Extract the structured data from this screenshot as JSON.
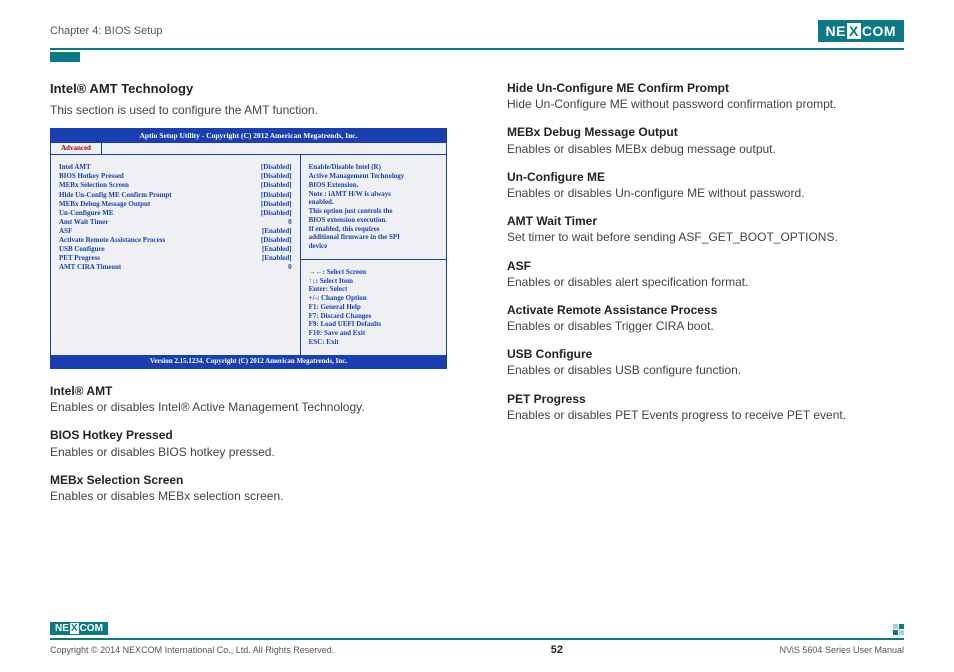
{
  "header": {
    "chapter": "Chapter 4: BIOS Setup",
    "logo_pre": "NE",
    "logo_x": "X",
    "logo_post": "COM"
  },
  "left": {
    "title": "Intel® AMT Technology",
    "intro": "This section is used to configure the AMT function.",
    "bios": {
      "title": "Aptio Setup Utility - Copyright (C) 2012 American Megatrends, Inc.",
      "tab": "Advanced",
      "rows": [
        {
          "k": "Intel AMT",
          "v": "[Disabled]"
        },
        {
          "k": "BIOS Hotkey Pressed",
          "v": "[Disabled]"
        },
        {
          "k": "MEBx Selection Screen",
          "v": "[Disabled]"
        },
        {
          "k": "Hide Un-Config ME Confirm Prompt",
          "v": "[Disabled]"
        },
        {
          "k": "MEBx Debug Message Output",
          "v": "[Disabled]"
        },
        {
          "k": "Un-Configure ME",
          "v": "[Disabled]"
        },
        {
          "k": "Amt Wait Timer",
          "v": "0"
        },
        {
          "k": "ASF",
          "v": "[Enabled]"
        },
        {
          "k": "Activate Remote Assistance Process",
          "v": "[Disabled]"
        },
        {
          "k": "USB Configure",
          "v": "[Enabled]"
        },
        {
          "k": "PET Progress",
          "v": "[Enabled]"
        },
        {
          "k": "AMT CIRA Timeout",
          "v": "0"
        }
      ],
      "help_top": [
        "Enable/Disable Intel (R)",
        "Active Management Technology",
        "BIOS Extension.",
        "Note : iAMT H/W is always",
        "enabled.",
        "This option just controls the",
        "BIOS extension execution.",
        "If enabled, this requires",
        "additional firmware in the SPI",
        "device"
      ],
      "help_bot": [
        "→←: Select Screen",
        "↑↓: Select Item",
        "Enter: Select",
        "+/-: Change Option",
        "F1: General Help",
        "F7: Discard Changes",
        "F9: Load UEFI Defaults",
        "F10: Save and Exit",
        "ESC: Exit"
      ],
      "footer": "Version 2.15.1234. Copyright (C) 2012 American Megatrends, Inc."
    },
    "items": [
      {
        "label": "Intel® AMT",
        "desc": "Enables or disables Intel® Active Management Technology."
      },
      {
        "label": "BIOS Hotkey Pressed",
        "desc": "Enables or disables BIOS hotkey pressed."
      },
      {
        "label": "MEBx Selection Screen",
        "desc": "Enables or disables MEBx selection screen."
      }
    ]
  },
  "right": {
    "items": [
      {
        "label": "Hide Un-Configure ME Confirm Prompt",
        "desc": "Hide Un-Configure ME without password confirmation prompt."
      },
      {
        "label": "MEBx Debug Message Output",
        "desc": "Enables or disables MEBx debug message output."
      },
      {
        "label": "Un-Configure ME",
        "desc": "Enables or disables Un-configure ME without password."
      },
      {
        "label": "AMT Wait Timer",
        "desc": "Set timer to wait before sending ASF_GET_BOOT_OPTIONS."
      },
      {
        "label": "ASF",
        "desc": "Enables or disables alert specification format."
      },
      {
        "label": "Activate Remote Assistance Process",
        "desc": "Enables or disables Trigger CIRA boot."
      },
      {
        "label": "USB Configure",
        "desc": "Enables or disables USB configure function."
      },
      {
        "label": "PET Progress",
        "desc": "Enables or disables PET Events progress to receive PET event."
      }
    ]
  },
  "footer": {
    "copyright": "Copyright © 2014 NEXCOM International Co., Ltd. All Rights Reserved.",
    "page": "52",
    "series": "NViS 5604 Series User Manual"
  }
}
